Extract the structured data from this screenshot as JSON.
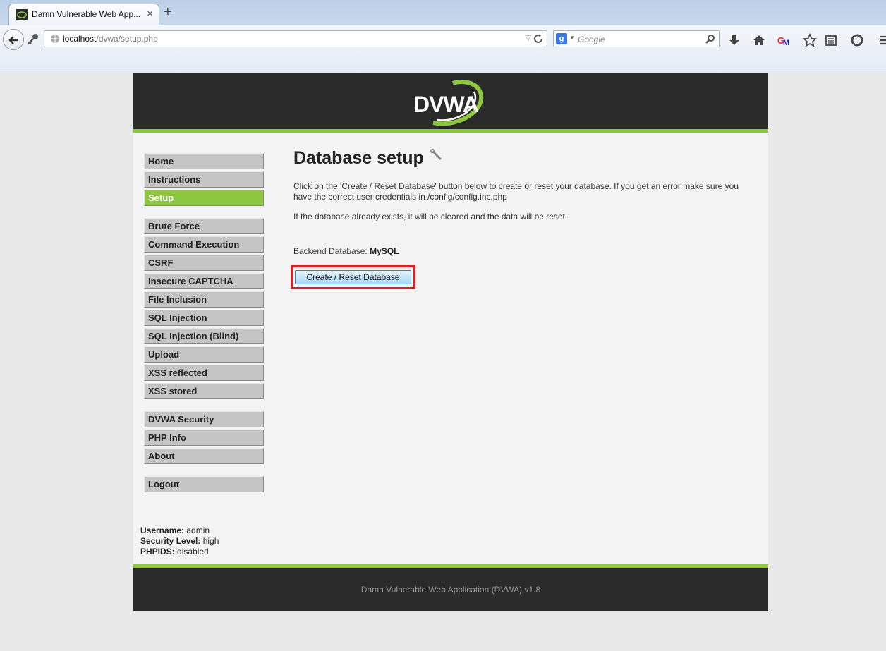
{
  "browser": {
    "tab_title": "Damn Vulnerable Web App...",
    "url_host": "localhost",
    "url_path": "/dvwa/setup.php",
    "search_placeholder": "Google"
  },
  "logo": {
    "text": "DVWA"
  },
  "menu": {
    "main": [
      "Home",
      "Instructions",
      "Setup"
    ],
    "vulns": [
      "Brute Force",
      "Command Execution",
      "CSRF",
      "Insecure CAPTCHA",
      "File Inclusion",
      "SQL Injection",
      "SQL Injection (Blind)",
      "Upload",
      "XSS reflected",
      "XSS stored"
    ],
    "other": [
      "DVWA Security",
      "PHP Info",
      "About"
    ],
    "logout": "Logout",
    "active": "Setup"
  },
  "content": {
    "title": "Database setup",
    "para1": "Click on the 'Create / Reset Database' button below to create or reset your database. If you get an error make sure you have the correct user credentials in /config/config.inc.php",
    "para2": "If the database already exists, it will be cleared and the data will be reset.",
    "backend_label": "Backend Database:",
    "backend_value": "MySQL",
    "button_label": "Create / Reset Database"
  },
  "user_info": {
    "username_label": "Username:",
    "username": "admin",
    "security_label": "Security Level:",
    "security": "high",
    "phpids_label": "PHPIDS:",
    "phpids": "disabled"
  },
  "footer": {
    "text": "Damn Vulnerable Web Application (DVWA) v1.8"
  },
  "colors": {
    "accent": "#8dc63f",
    "header_bg": "#2a2a2a",
    "highlight": "#e41b23"
  }
}
